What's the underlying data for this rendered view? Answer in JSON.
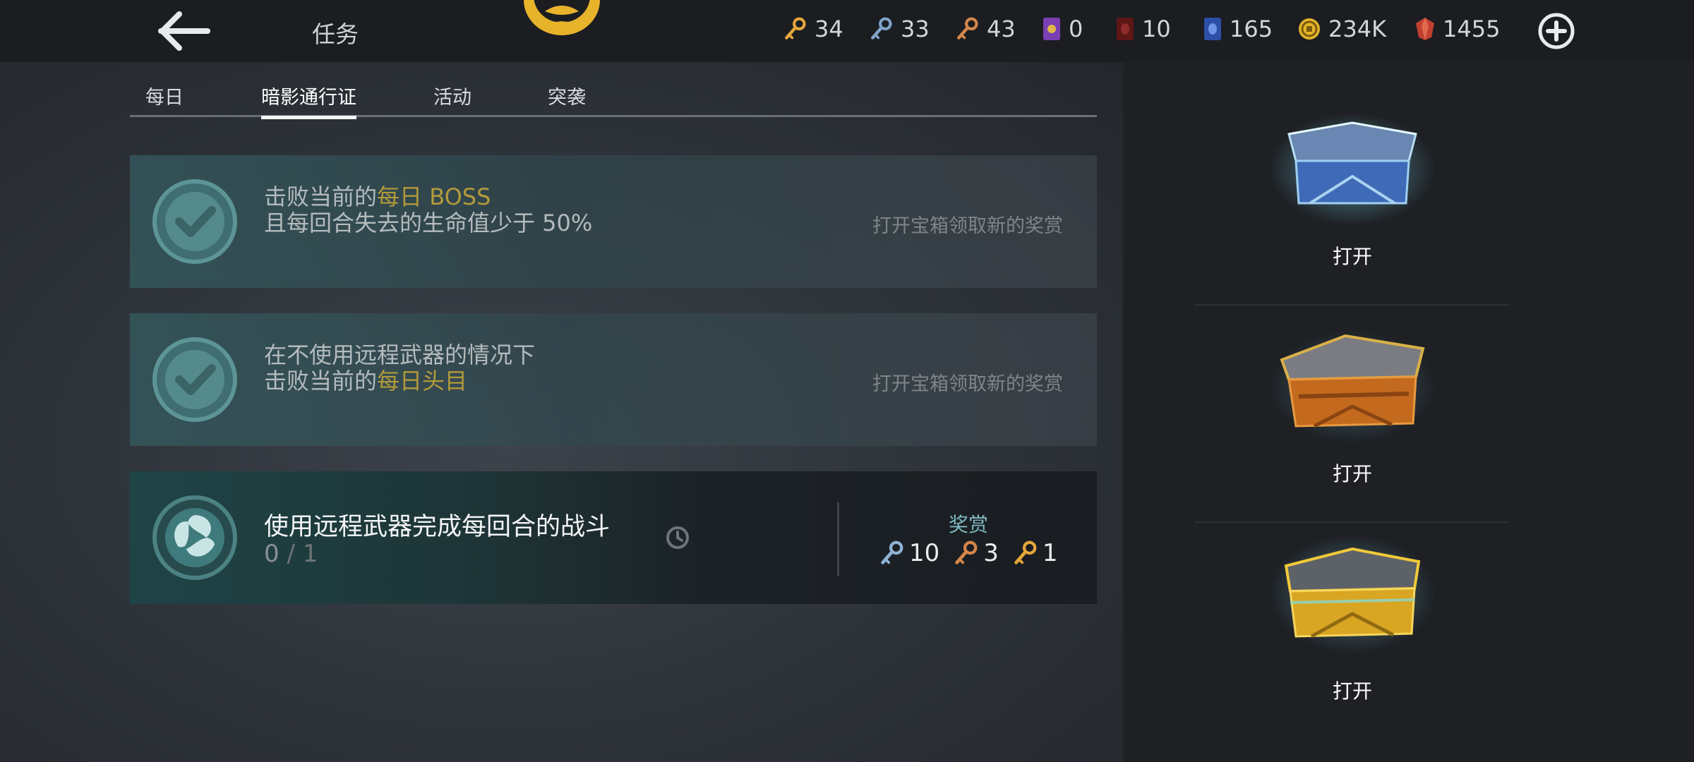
{
  "header": {
    "title": "任务",
    "resources": [
      {
        "icon": "gold-key-icon",
        "value": "34",
        "color": "#e5a63a"
      },
      {
        "icon": "silver-key-icon",
        "value": "33",
        "color": "#7fa3c8"
      },
      {
        "icon": "bronze-key-icon",
        "value": "43",
        "color": "#d6864a"
      },
      {
        "icon": "purple-ticket-icon",
        "value": "0",
        "color": "#7a3fb2"
      },
      {
        "icon": "red-gem-card-icon",
        "value": "10",
        "color": "#7a2121"
      },
      {
        "icon": "blue-gem-card-icon",
        "value": "165",
        "color": "#3a64c8"
      },
      {
        "icon": "coin-icon",
        "value": "234K",
        "color": "#e4b52a"
      },
      {
        "icon": "ruby-icon",
        "value": "1455",
        "color": "#c24030"
      }
    ]
  },
  "tabs": [
    "每日",
    "暗影通行证",
    "活动",
    "突袭"
  ],
  "active_tab": "暗影通行证",
  "quests": [
    {
      "line1_prefix": "击败当前的",
      "line1_highlight": "每日 BOSS",
      "line2": "且每回合失去的生命值少于 50%",
      "status": "打开宝箱领取新的奖赏",
      "state": "completed"
    },
    {
      "line1": "在不使用远程武器的情况下",
      "line2_prefix": "击败当前的",
      "line2_highlight": "每日头目",
      "status": "打开宝箱领取新的奖赏",
      "state": "completed"
    },
    {
      "title": "使用远程武器完成每回合的战斗",
      "progress_current": "0",
      "progress_sep": " / ",
      "progress_total": "1",
      "reward_label": "奖赏",
      "rewards": [
        {
          "icon": "silver-key-icon",
          "amount": "10"
        },
        {
          "icon": "bronze-key-icon",
          "amount": "3"
        },
        {
          "icon": "gold-key-icon",
          "amount": "1"
        }
      ],
      "state": "in-progress"
    }
  ],
  "chests": [
    {
      "type": "silver-chest",
      "label": "打开"
    },
    {
      "type": "bronze-chest",
      "label": "打开"
    },
    {
      "type": "gold-chest",
      "label": "打开"
    }
  ],
  "colors": {
    "highlight": "#b49a3c",
    "reward_label": "#7fb9c0",
    "medal_teal": "#4f8a8c"
  }
}
